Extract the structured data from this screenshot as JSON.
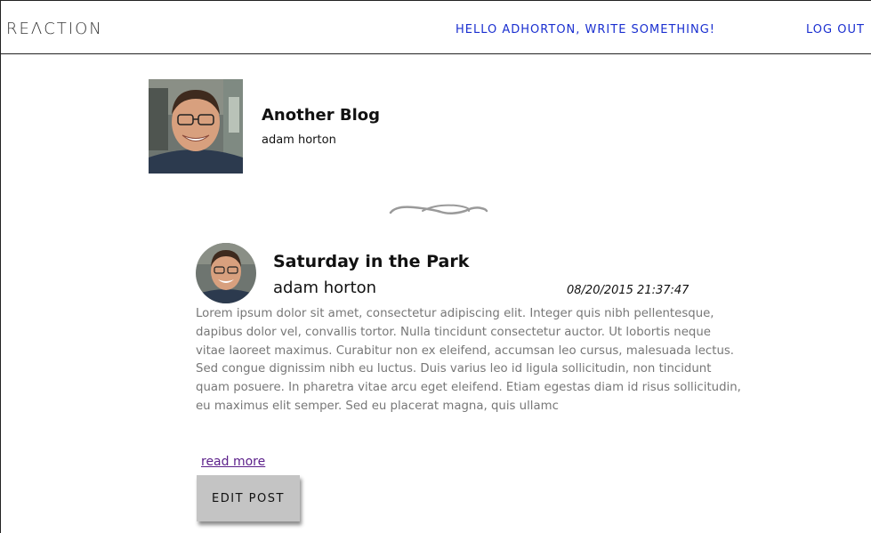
{
  "navbar": {
    "brand": "REΛCTION",
    "write_link": "HELLO ADHORTON, WRITE SOMETHING!",
    "logout_link": "LOG OUT",
    "link_color": "#1a2fd0"
  },
  "blog": {
    "title": "Another Blog",
    "author": "adam horton",
    "avatar_icon": "user-photo"
  },
  "divider": {
    "icon": "ornament-divider-icon"
  },
  "post": {
    "title": "Saturday in the Park",
    "author": "adam horton",
    "date": "08/20/2015 21:37:47",
    "body": "Lorem ipsum dolor sit amet, consectetur adipiscing elit. Integer quis nibh pellentesque, dapibus dolor vel, convallis tortor. Nulla tincidunt consectetur auctor. Ut lobortis neque vitae laoreet maximus. Curabitur non ex eleifend, accumsan leo cursus, malesuada lectus. Sed congue dignissim nibh eu luctus. Duis varius leo id ligula sollicitudin, non tincidunt quam posuere. In pharetra vitae arcu eget eleifend. Etiam egestas diam id risus sollicitudin, eu maximus elit semper. Sed eu placerat magna, quis ullamc",
    "read_more": "read more",
    "edit_button": "EDIT POST"
  }
}
